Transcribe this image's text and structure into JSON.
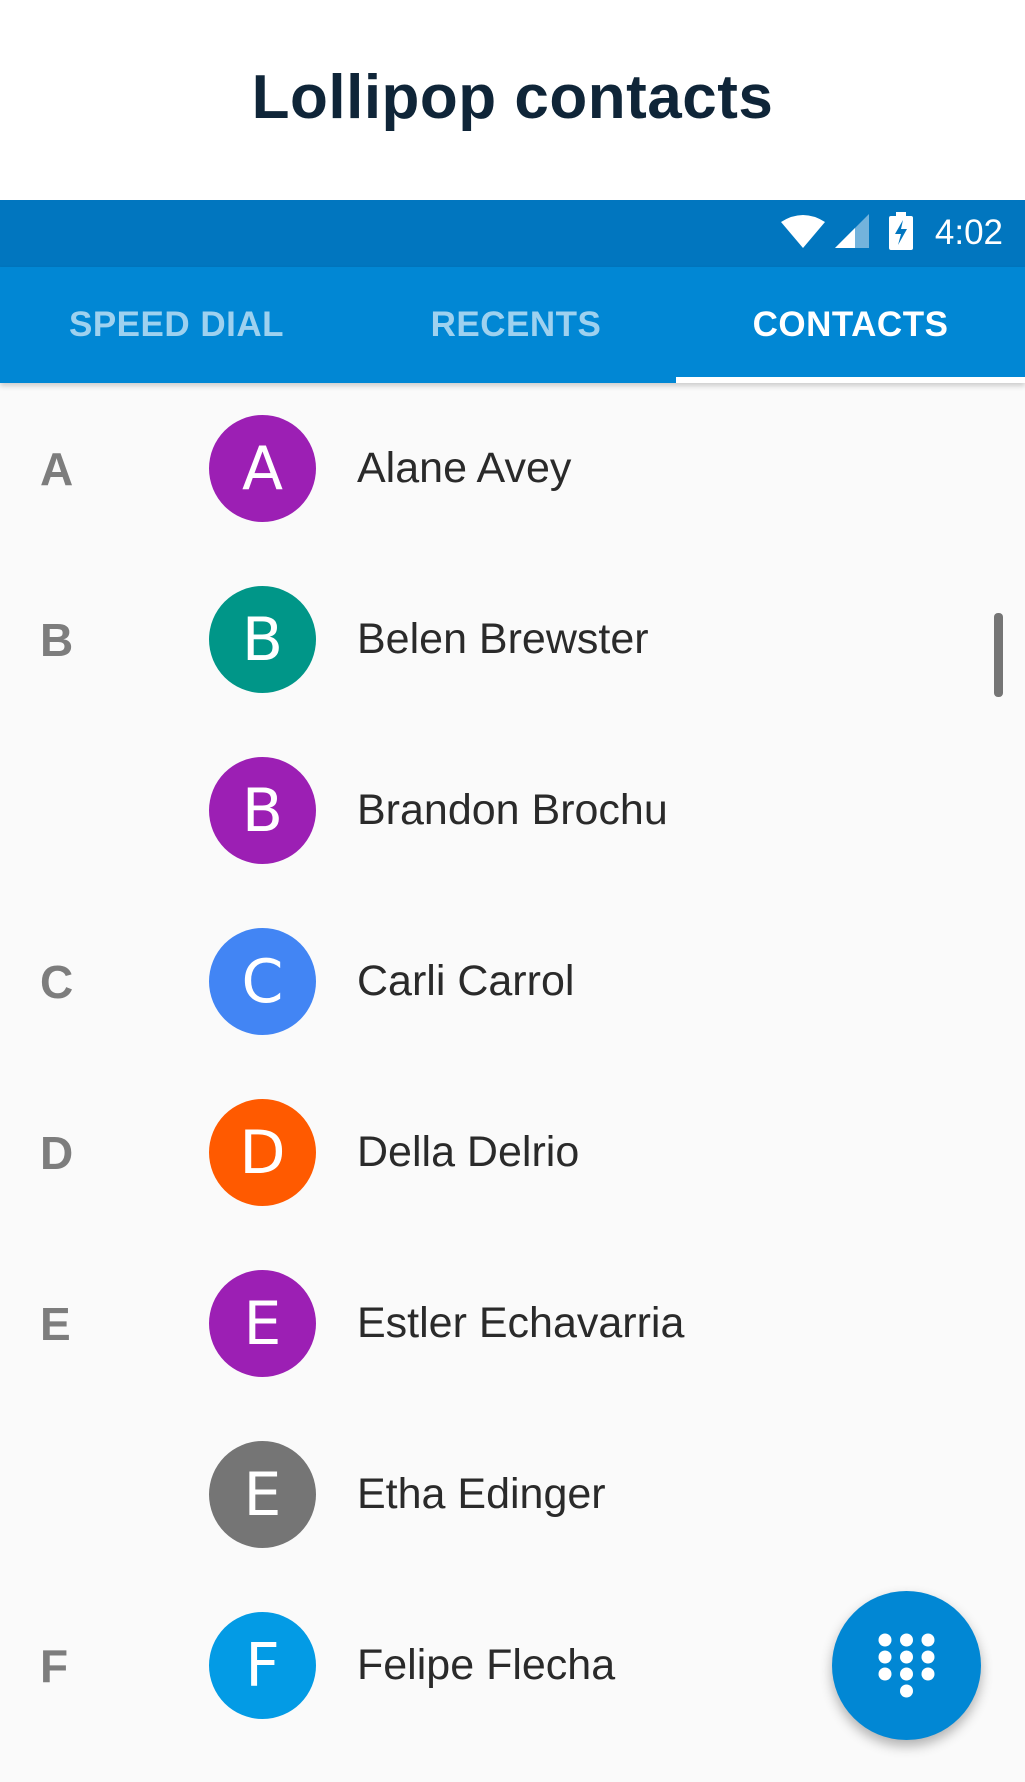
{
  "page": {
    "title": "Lollipop contacts"
  },
  "status_bar": {
    "time": "4:02",
    "icons": [
      "wifi-icon",
      "cell-signal-icon",
      "battery-charging-icon"
    ]
  },
  "tabs": [
    {
      "label": "SPEED DIAL",
      "active": false
    },
    {
      "label": "RECENTS",
      "active": false
    },
    {
      "label": "CONTACTS",
      "active": true
    }
  ],
  "contacts": [
    {
      "section": "A",
      "initial": "A",
      "name": "Alane Avey",
      "color": "#9c1fb4"
    },
    {
      "section": "B",
      "initial": "B",
      "name": "Belen Brewster",
      "color": "#009688"
    },
    {
      "section": "",
      "initial": "B",
      "name": "Brandon Brochu",
      "color": "#9c1fb4"
    },
    {
      "section": "C",
      "initial": "C",
      "name": "Carli Carrol",
      "color": "#4285f4"
    },
    {
      "section": "D",
      "initial": "D",
      "name": "Della Delrio",
      "color": "#ff5a00"
    },
    {
      "section": "E",
      "initial": "E",
      "name": "Estler Echavarria",
      "color": "#9c1fb4"
    },
    {
      "section": "",
      "initial": "E",
      "name": "Etha Edinger",
      "color": "#757575"
    },
    {
      "section": "F",
      "initial": "F",
      "name": "Felipe Flecha",
      "color": "#039be5"
    }
  ],
  "fab": {
    "icon": "dialpad-icon"
  },
  "colors": {
    "status_bar": "#0176bf",
    "tab_bar": "#0187d4",
    "fab": "#0187d4",
    "title": "#0f2538"
  }
}
